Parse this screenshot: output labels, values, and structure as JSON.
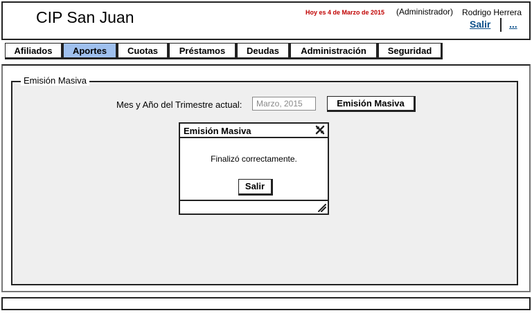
{
  "header": {
    "title": "CIP San Juan",
    "date_text": "Hoy es 4 de Marzo de 2015",
    "role": "(Administrador)",
    "user_name": "Rodrigo Herrera",
    "logout_label": "Salir",
    "more_label": "..."
  },
  "tabs": [
    {
      "label": "Afiliados",
      "selected": false
    },
    {
      "label": "Aportes",
      "selected": true
    },
    {
      "label": "Cuotas",
      "selected": false
    },
    {
      "label": "Préstamos",
      "selected": false
    },
    {
      "label": "Deudas",
      "selected": false
    },
    {
      "label": "Administración",
      "selected": false
    },
    {
      "label": "Seguridad",
      "selected": false
    }
  ],
  "main": {
    "fieldset_legend": "Emisión Masiva",
    "period_label": "Mes y Año del Trimestre actual:",
    "period_value": "Marzo, 2015",
    "emit_button_label": "Emisión Masiva"
  },
  "dialog": {
    "title": "Emisión Masiva",
    "message": "Finalizó correctamente.",
    "button_label": "Salir",
    "close_icon": "close-icon",
    "resize_icon": "resize-grip-icon"
  },
  "colors": {
    "selected_tab": "#9fc0ee",
    "date_text": "#c00000",
    "link": "#0b4f8a",
    "panel_background": "#efefef"
  }
}
